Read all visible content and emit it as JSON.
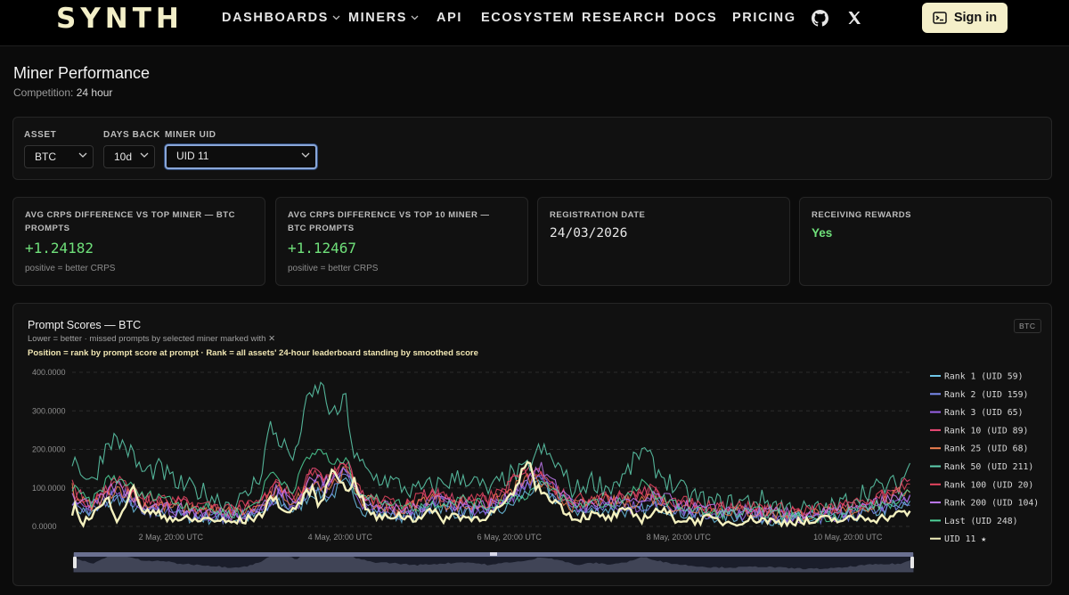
{
  "nav": {
    "logo": "SYNTH",
    "items": [
      {
        "label": "DASHBOARDS",
        "dropdown": true
      },
      {
        "label": "MINERS",
        "dropdown": true
      },
      {
        "label": "API",
        "dropdown": false
      },
      {
        "label": "ECOSYSTEM",
        "dropdown": false
      },
      {
        "label": "RESEARCH",
        "dropdown": false
      },
      {
        "label": "DOCS",
        "dropdown": false
      },
      {
        "label": "PRICING",
        "dropdown": false
      }
    ],
    "icons": [
      "github-icon",
      "x-icon"
    ],
    "signin_label": "Sign in"
  },
  "header": {
    "title": "Miner Performance",
    "competition_label": "Competition:",
    "competition_value": "24 hour"
  },
  "filters": {
    "asset": {
      "label": "ASSET",
      "value": "BTC"
    },
    "days_back": {
      "label": "DAYS BACK",
      "value": "10d"
    },
    "miner_uid": {
      "label": "MINER UID",
      "value": "UID 11"
    }
  },
  "cards": [
    {
      "label": "AVG CRPS DIFFERENCE VS TOP MINER — BTC PROMPTS",
      "value": "+1.24182",
      "note": "positive = better CRPS",
      "value_color": "#6fe07a"
    },
    {
      "label": "AVG CRPS DIFFERENCE VS TOP 10 MINER — BTC PROMPTS",
      "value": "+1.12467",
      "note": "positive = better CRPS",
      "value_color": "#6fe07a"
    },
    {
      "label": "REGISTRATION DATE",
      "value": "24/03/2026",
      "note": "",
      "value_color": "#e6e6e6"
    },
    {
      "label": "RECEIVING REWARDS",
      "value": "Yes",
      "note": "",
      "value_color": "#6fe07a"
    }
  ],
  "chart": {
    "title": "Prompt Scores — BTC",
    "subtitle": "Lower = better · missed prompts by selected miner marked with ✕",
    "subtitle2": "Position = rank by prompt score at prompt · Rank = all assets' 24-hour leaderboard standing by smoothed score",
    "badge": "BTC"
  },
  "chart_data": {
    "type": "line",
    "ylim": [
      0,
      400
    ],
    "y_ticks": [
      "400.0000",
      "300.0000",
      "200.0000",
      "100.0000",
      "0.0000"
    ],
    "x_ticks": [
      "2 May, 20:00 UTC",
      "4 May, 20:00 UTC",
      "6 May, 20:00 UTC",
      "8 May, 20:00 UTC",
      "10 May, 20:00 UTC"
    ],
    "x_tick_days": [
      2.833,
      4.833,
      6.833,
      8.833,
      10.833
    ],
    "xlim_days": [
      1.667,
      11.583
    ],
    "grid": true,
    "legend_position": "right",
    "series": [
      {
        "name": "Rank 1 (UID 59)",
        "color": "#6fc6e8"
      },
      {
        "name": "Rank 2 (UID 159)",
        "color": "#7b8cf0"
      },
      {
        "name": "Rank 3 (UID 65)",
        "color": "#9a62e8"
      },
      {
        "name": "Rank 10 (UID 89)",
        "color": "#f04b78"
      },
      {
        "name": "Rank 25 (UID 68)",
        "color": "#f08050"
      },
      {
        "name": "Rank 50 (UID 211)",
        "color": "#5fd0b0"
      },
      {
        "name": "Rank 100 (UID 20)",
        "color": "#e64560"
      },
      {
        "name": "Rank 200 (UID 104)",
        "color": "#c07af0"
      },
      {
        "name": "Last (UID 248)",
        "color": "#4fd39a"
      },
      {
        "name": "UID 11 ★",
        "color": "#f4f1bf",
        "highlight": true
      }
    ],
    "anchors": {
      "Rank 50 (UID 211)": [
        [
          1.67,
          180
        ],
        [
          1.9,
          110
        ],
        [
          2.1,
          230
        ],
        [
          2.3,
          210
        ],
        [
          2.5,
          140
        ],
        [
          2.7,
          150
        ],
        [
          2.9,
          110
        ],
        [
          3.2,
          90
        ],
        [
          3.5,
          60
        ],
        [
          3.7,
          70
        ],
        [
          3.9,
          140
        ],
        [
          4.0,
          260
        ],
        [
          4.1,
          230
        ],
        [
          4.3,
          170
        ],
        [
          4.4,
          300
        ],
        [
          4.6,
          370
        ],
        [
          4.75,
          280
        ],
        [
          4.9,
          330
        ],
        [
          5.0,
          180
        ],
        [
          5.2,
          130
        ],
        [
          5.4,
          120
        ],
        [
          5.7,
          90
        ],
        [
          6.0,
          110
        ],
        [
          6.3,
          130
        ],
        [
          6.6,
          90
        ],
        [
          6.8,
          130
        ],
        [
          7.0,
          140
        ],
        [
          7.2,
          200
        ],
        [
          7.4,
          160
        ],
        [
          7.6,
          90
        ],
        [
          7.8,
          120
        ],
        [
          8.0,
          100
        ],
        [
          8.2,
          130
        ],
        [
          8.4,
          200
        ],
        [
          8.6,
          140
        ],
        [
          8.8,
          100
        ],
        [
          9.0,
          80
        ],
        [
          9.2,
          60
        ],
        [
          9.5,
          60
        ],
        [
          9.8,
          70
        ],
        [
          10.1,
          50
        ],
        [
          10.4,
          40
        ],
        [
          10.7,
          50
        ],
        [
          11.0,
          90
        ],
        [
          11.2,
          100
        ],
        [
          11.45,
          110
        ],
        [
          11.58,
          170
        ]
      ],
      "Rank 10 (UID 89)": [
        [
          1.67,
          90
        ],
        [
          1.9,
          60
        ],
        [
          2.2,
          120
        ],
        [
          2.5,
          70
        ],
        [
          2.8,
          60
        ],
        [
          3.2,
          50
        ],
        [
          3.6,
          40
        ],
        [
          3.9,
          60
        ],
        [
          4.1,
          110
        ],
        [
          4.3,
          70
        ],
        [
          4.5,
          140
        ],
        [
          4.7,
          120
        ],
        [
          4.9,
          170
        ],
        [
          5.1,
          80
        ],
        [
          5.3,
          60
        ],
        [
          5.6,
          50
        ],
        [
          5.9,
          90
        ],
        [
          6.1,
          70
        ],
        [
          6.4,
          60
        ],
        [
          6.7,
          80
        ],
        [
          6.9,
          120
        ],
        [
          7.1,
          150
        ],
        [
          7.3,
          110
        ],
        [
          7.6,
          60
        ],
        [
          7.9,
          80
        ],
        [
          8.2,
          70
        ],
        [
          8.5,
          90
        ],
        [
          8.8,
          60
        ],
        [
          9.1,
          50
        ],
        [
          9.4,
          50
        ],
        [
          9.7,
          45
        ],
        [
          10.0,
          40
        ],
        [
          10.3,
          35
        ],
        [
          10.6,
          40
        ],
        [
          10.9,
          50
        ],
        [
          11.2,
          70
        ],
        [
          11.45,
          100
        ],
        [
          11.58,
          120
        ]
      ],
      "Rank 3 (UID 65)": [
        [
          1.67,
          70
        ],
        [
          1.9,
          40
        ],
        [
          2.2,
          100
        ],
        [
          2.5,
          50
        ],
        [
          2.8,
          40
        ],
        [
          3.2,
          30
        ],
        [
          3.6,
          25
        ],
        [
          3.9,
          40
        ],
        [
          4.1,
          90
        ],
        [
          4.3,
          50
        ],
        [
          4.5,
          120
        ],
        [
          4.7,
          100
        ],
        [
          4.9,
          150
        ],
        [
          5.1,
          60
        ],
        [
          5.4,
          40
        ],
        [
          5.7,
          35
        ],
        [
          6.0,
          70
        ],
        [
          6.2,
          50
        ],
        [
          6.5,
          45
        ],
        [
          6.8,
          60
        ],
        [
          7.0,
          110
        ],
        [
          7.2,
          140
        ],
        [
          7.4,
          90
        ],
        [
          7.7,
          45
        ],
        [
          8.0,
          60
        ],
        [
          8.3,
          50
        ],
        [
          8.6,
          70
        ],
        [
          8.9,
          45
        ],
        [
          9.2,
          35
        ],
        [
          9.5,
          35
        ],
        [
          9.8,
          30
        ],
        [
          10.1,
          25
        ],
        [
          10.4,
          25
        ],
        [
          10.7,
          30
        ],
        [
          11.0,
          40
        ],
        [
          11.3,
          60
        ],
        [
          11.58,
          70
        ]
      ],
      "UID 11 ★": [
        [
          1.67,
          60
        ],
        [
          1.8,
          10
        ],
        [
          1.95,
          40
        ],
        [
          2.1,
          70
        ],
        [
          2.2,
          20
        ],
        [
          2.4,
          100
        ],
        [
          2.5,
          40
        ],
        [
          2.7,
          30
        ],
        [
          2.9,
          20
        ],
        [
          3.1,
          15
        ],
        [
          3.3,
          20
        ],
        [
          3.5,
          10
        ],
        [
          3.7,
          15
        ],
        [
          3.9,
          30
        ],
        [
          4.05,
          80
        ],
        [
          4.2,
          30
        ],
        [
          4.35,
          60
        ],
        [
          4.5,
          100
        ],
        [
          4.6,
          50
        ],
        [
          4.75,
          160
        ],
        [
          4.9,
          90
        ],
        [
          5.0,
          120
        ],
        [
          5.15,
          40
        ],
        [
          5.3,
          20
        ],
        [
          5.5,
          30
        ],
        [
          5.7,
          20
        ],
        [
          5.9,
          40
        ],
        [
          6.05,
          20
        ],
        [
          6.2,
          30
        ],
        [
          6.4,
          20
        ],
        [
          6.6,
          30
        ],
        [
          6.8,
          60
        ],
        [
          6.9,
          90
        ],
        [
          7.05,
          180
        ],
        [
          7.15,
          100
        ],
        [
          7.3,
          80
        ],
        [
          7.45,
          50
        ],
        [
          7.6,
          20
        ],
        [
          7.8,
          30
        ],
        [
          8.0,
          20
        ],
        [
          8.2,
          40
        ],
        [
          8.4,
          20
        ],
        [
          8.6,
          45
        ],
        [
          8.8,
          20
        ],
        [
          9.0,
          15
        ],
        [
          9.2,
          20
        ],
        [
          9.4,
          10
        ],
        [
          9.6,
          15
        ],
        [
          9.8,
          20
        ],
        [
          10.0,
          10
        ],
        [
          10.2,
          15
        ],
        [
          10.4,
          10
        ],
        [
          10.6,
          20
        ],
        [
          10.8,
          15
        ],
        [
          11.0,
          25
        ],
        [
          11.2,
          20
        ],
        [
          11.4,
          30
        ],
        [
          11.58,
          40
        ]
      ]
    }
  }
}
